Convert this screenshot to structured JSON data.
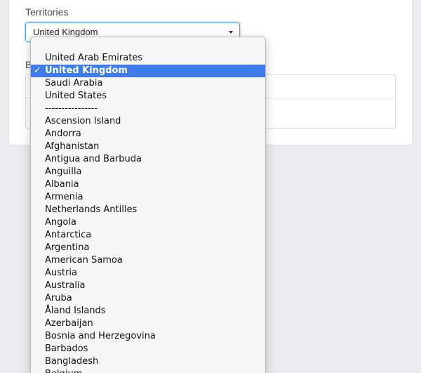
{
  "form": {
    "territories_label": "Territories",
    "selected_value": "United Kingdom",
    "second_label": "B"
  },
  "dropdown": {
    "check_mark": "✓",
    "options": [
      "United Arab Emirates",
      "United Kingdom",
      "Saudi Arabia",
      "United States",
      "----------------",
      "Ascension Island",
      "Andorra",
      "Afghanistan",
      "Antigua and Barbuda",
      "Anguilla",
      "Albania",
      "Armenia",
      "Netherlands Antilles",
      "Angola",
      "Antarctica",
      "Argentina",
      "American Samoa",
      "Austria",
      "Australia",
      "Aruba",
      "Åland Islands",
      "Azerbaijan",
      "Bosnia and Herzegovina",
      "Barbados",
      "Bangladesh",
      "Belgium"
    ]
  },
  "colors": {
    "selection": "#3f7be9",
    "focus_border": "#5b9de0",
    "background": "#ececee"
  }
}
